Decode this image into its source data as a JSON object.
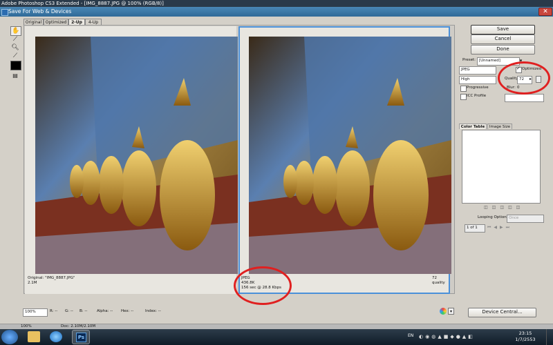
{
  "window": {
    "app_title": "Adobe Photoshop CS3 Extended - [IMG_8887.JPG @ 100% (RGB/8)]",
    "dialog_title": "Save For Web & Devices"
  },
  "tabs": [
    "Original",
    "Optimized",
    "2-Up",
    "4-Up"
  ],
  "active_tab": "2-Up",
  "left_pane": {
    "line1": "Original: \"IMG_8887.JPG\"",
    "line2": "2.1M"
  },
  "right_pane": {
    "format": "JPEG",
    "size": "436.8K",
    "time": "156 sec @ 28.8 Kbps",
    "quality_info": "72 quality"
  },
  "buttons": {
    "save": "Save",
    "cancel": "Cancel",
    "done": "Done",
    "device_central": "Device Central..."
  },
  "settings": {
    "preset_label": "Preset:",
    "preset_value": "[Unnamed]",
    "format_value": "JPEG",
    "optimized_label": "Optimized",
    "quality_level": "High",
    "quality_label": "Quality:",
    "quality_value": "72",
    "progressive_label": "Progressive",
    "blur_label": "Blur:",
    "blur_value": "0",
    "icc_label": "ICC Profile",
    "optimized_checked": true
  },
  "color_panel": {
    "tab_color": "Color Table",
    "tab_size": "Image Size",
    "looping_label": "Looping Options:",
    "looping_value": "Once",
    "frame_counter": "1 of 1"
  },
  "statusbar": {
    "zoom": "100%",
    "r": "R: --",
    "g": "G: --",
    "b": "B: --",
    "alpha": "Alpha: --",
    "hex": "Hex: --",
    "index": "Index: --"
  },
  "ps_status": {
    "zoom": "100%",
    "doc": "Doc: 2.10M/2.10M"
  },
  "taskbar": {
    "lang": "EN",
    "time": "23:15",
    "date": "1/7/2553"
  },
  "colors": {
    "accent_blue": "#4a90d9",
    "highlight_red": "#e02020"
  },
  "icons": [
    "hand-tool-icon",
    "slice-select-icon",
    "zoom-icon",
    "eyedropper-icon",
    "eyedropper-color-icon",
    "toggle-slices-icon"
  ]
}
